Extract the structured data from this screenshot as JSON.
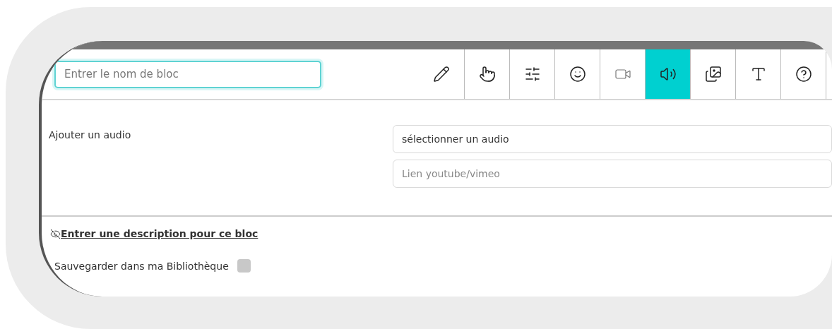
{
  "block_name": {
    "placeholder": "Entrer le nom de bloc"
  },
  "tools": [
    {
      "kind": "pencil",
      "selected": false
    },
    {
      "kind": "hand",
      "selected": false
    },
    {
      "kind": "sliders",
      "selected": false
    },
    {
      "kind": "smile",
      "selected": false
    },
    {
      "kind": "video",
      "selected": false
    },
    {
      "kind": "audio",
      "selected": true
    },
    {
      "kind": "images",
      "selected": false
    },
    {
      "kind": "text",
      "selected": false
    },
    {
      "kind": "help",
      "selected": false
    }
  ],
  "audio": {
    "label": "Ajouter un audio",
    "select": {
      "value": "sélectionner un audio"
    },
    "link": {
      "placeholder": "Lien youtube/vimeo"
    }
  },
  "description_link": "Entrer une description pour ce bloc",
  "save": {
    "label": "Sauvegarder dans ma Bibliothèque",
    "checked": false
  }
}
